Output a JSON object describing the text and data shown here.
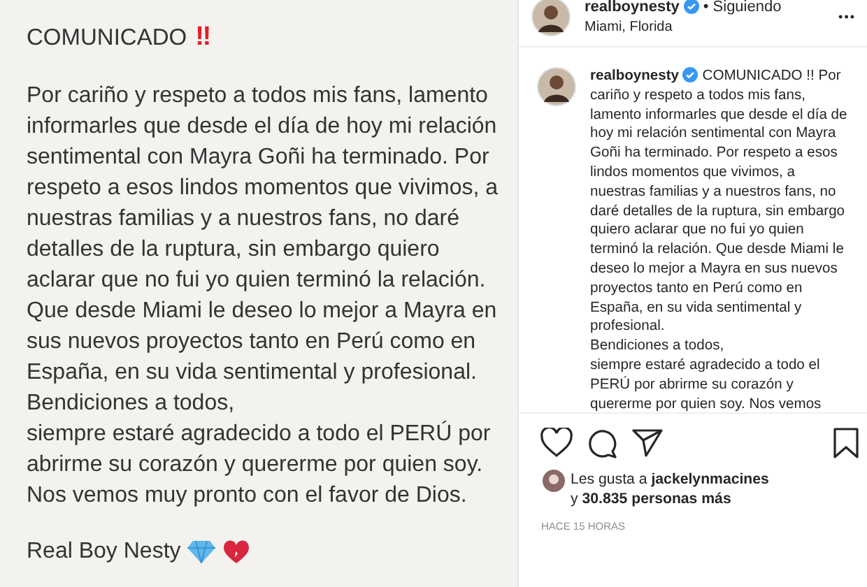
{
  "note": {
    "title": "COMUNICADO",
    "title_mark": "‼",
    "paragraphs": [
      "Por cariño y respeto a todos mis fans, lamento informarles que desde el día de hoy mi relación sentimental con Mayra Goñi ha terminado. Por respeto a esos lindos momentos que vivimos, a nuestras familias y a nuestros fans, no daré detalles de la ruptura, sin embargo quiero aclarar que no fui yo quien terminó la relación. Que desde Miami le deseo lo mejor a Mayra en sus nuevos proyectos tanto en Perú como en España, en su vida sentimental y profesional.\nBendiciones a todos,\nsiempre estaré agradecido a todo el PERÚ por abrirme su corazón y quererme por quien soy.\nNos vemos muy pronto con el favor de Dios."
    ],
    "signature": "Real Boy Nesty"
  },
  "post": {
    "username": "realboynesty",
    "verified": true,
    "follow_status": "• Siguiendo",
    "location": "Miami, Florida",
    "more": "•••",
    "caption": {
      "username": "realboynesty",
      "text": "COMUNICADO !! Por cariño y respeto a todos mis fans,\nlamento informarles que desde el día de hoy mi relación sentimental con Mayra Goñi ha terminado. Por respeto a esos lindos momentos que vivimos, a nuestras familias y a nuestros fans, no daré detalles de la ruptura, sin embargo quiero aclarar que no fui yo quien terminó la relación. Que desde Miami le deseo lo mejor a Mayra en sus nuevos proyectos tanto en Perú como en España, en su vida sentimental y profesional.\nBendiciones a todos,\nsiempre estaré agradecido a todo el PERÚ por abrirme su corazón y quererme por quien soy. Nos vemos"
    },
    "liked": false,
    "saved": false,
    "likes": "Les gusta a **jackelynmacines** y **30.835 personas más**",
    "time": "HACE 15 HORAS"
  }
}
